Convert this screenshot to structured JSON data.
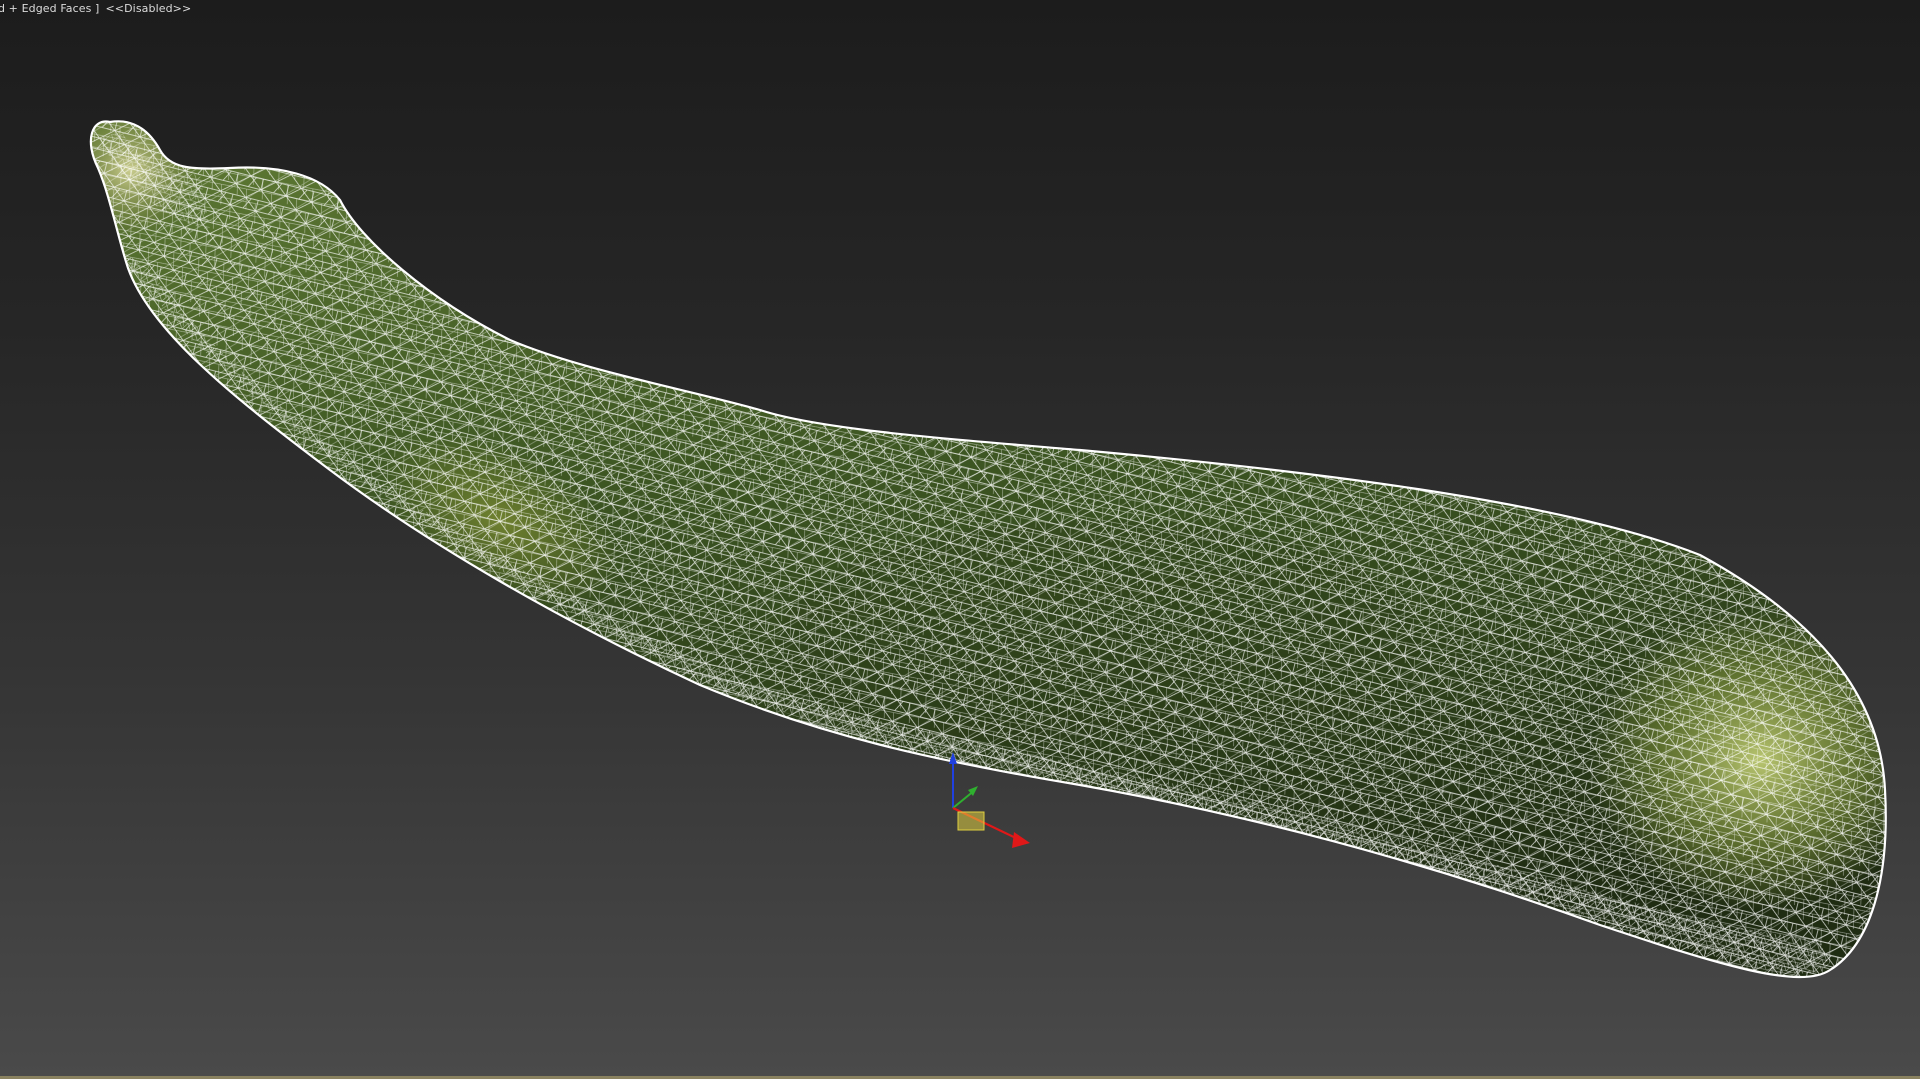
{
  "viewport": {
    "label_shading": "d + Edged Faces ]",
    "label_status": "<<Disabled>>"
  },
  "model": {
    "name": "zucchini",
    "display_mode": "wireframe-over-shaded",
    "wire_color": "#ffffff",
    "body_color": "#3f5a22",
    "highlight_color": "#b9c66a"
  },
  "gizmo": {
    "axes": [
      "x-axis",
      "y-axis",
      "z-axis"
    ],
    "x_color": "#e01818",
    "y_color": "#2fb02f",
    "z_color": "#2040e0",
    "pivot_color": "#e0d040"
  },
  "background": {
    "top_color": "#1c1c1c",
    "bottom_color": "#4a4a4a"
  }
}
